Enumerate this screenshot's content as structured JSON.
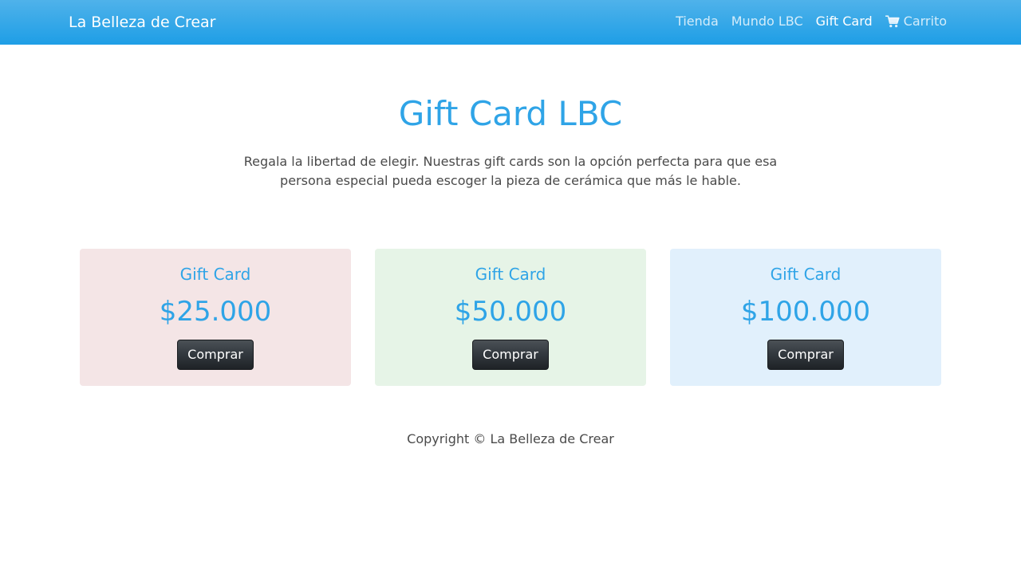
{
  "navbar": {
    "brand": "La Belleza de Crear",
    "links": [
      {
        "label": "Tienda"
      },
      {
        "label": "Mundo LBC"
      },
      {
        "label": "Gift Card"
      },
      {
        "label": "Carrito",
        "icon": "cart-icon"
      }
    ],
    "background": "#1e9ee6"
  },
  "main": {
    "title": "Gift Card LBC",
    "description": "Regala la libertad de elegir. Nuestras gift cards son la opción perfecta para que esa persona especial pueda escoger la pieza de cerámica que más le hable."
  },
  "cards": [
    {
      "title": "Gift Card",
      "price": "$25.000",
      "button": "Comprar",
      "background": "#f4e5e6"
    },
    {
      "title": "Gift Card",
      "price": "$50.000",
      "button": "Comprar",
      "background": "#e6f4e7"
    },
    {
      "title": "Gift Card",
      "price": "$100.000",
      "button": "Comprar",
      "background": "#e1f0fc"
    }
  ],
  "footer": {
    "text": "Copyright © La Belleza de Crear"
  },
  "colors": {
    "accent": "#2fa4e7",
    "button": "#343a40"
  }
}
